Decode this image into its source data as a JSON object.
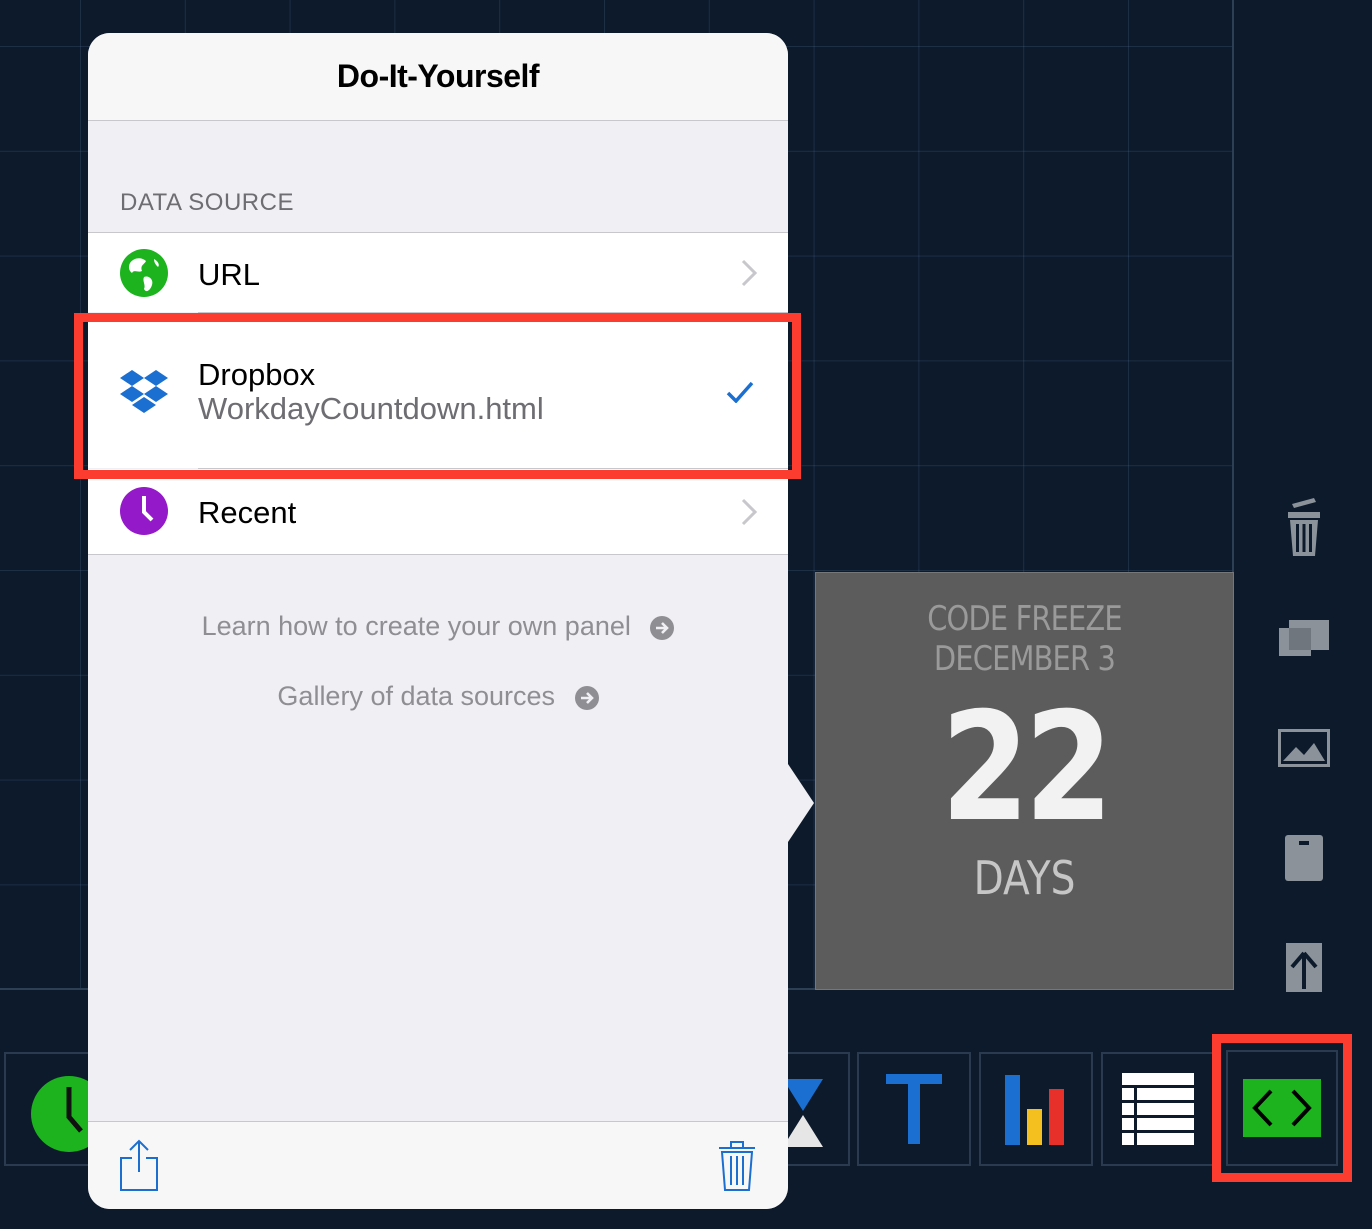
{
  "popover": {
    "title": "Do-It-Yourself",
    "section_header": "DATA SOURCE",
    "rows": [
      {
        "label": "URL",
        "icon": "globe-icon",
        "accessory": "chevron"
      },
      {
        "label": "Dropbox",
        "sublabel": "WorkdayCountdown.html",
        "icon": "dropbox-icon",
        "accessory": "checkmark",
        "selected": true
      },
      {
        "label": "Recent",
        "icon": "clock-icon",
        "accessory": "chevron"
      }
    ],
    "links": [
      {
        "label": "Learn how to create your own panel"
      },
      {
        "label": "Gallery of data sources"
      }
    ],
    "footer": {
      "left_icon": "share-icon",
      "right_icon": "trash-icon"
    }
  },
  "countdown": {
    "title_line1": "CODE FREEZE",
    "title_line2": "DECEMBER 3",
    "value": "22",
    "unit": "DAYS"
  },
  "right_tools": [
    "trash-icon",
    "window-icon",
    "image-icon",
    "panel-icon",
    "upload-icon"
  ],
  "panel_library": [
    "clock-panel",
    "hourglass-panel",
    "text-panel",
    "bar-chart-panel",
    "list-panel",
    "diy-code-panel"
  ],
  "colors": {
    "background": "#0c1a2c",
    "highlight": "#fb3c2e",
    "ios_blue": "#1b6fd1",
    "green": "#1cb31f",
    "purple": "#9419c9"
  }
}
